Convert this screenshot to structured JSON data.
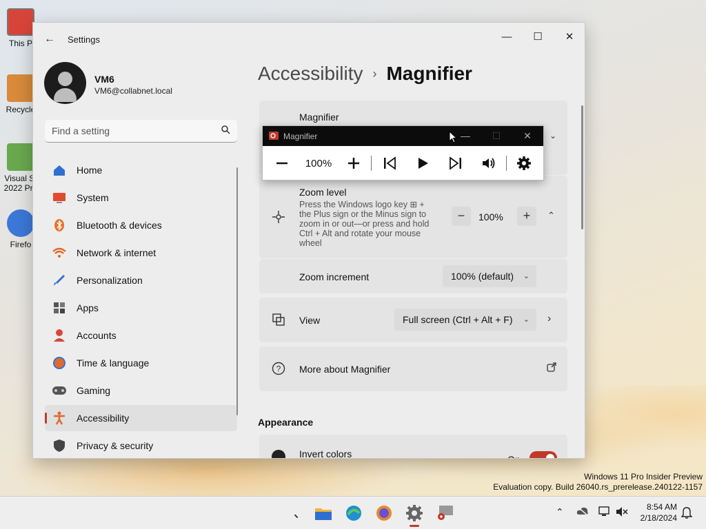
{
  "desktop": {
    "icons": [
      {
        "label": "This P"
      },
      {
        "label": "Recycle"
      },
      {
        "label": "Visual St",
        "label2": "2022 Pre"
      },
      {
        "label": "Firefo"
      }
    ]
  },
  "window": {
    "title": "Settings",
    "controls": {
      "minimize": "—",
      "maximize": "☐",
      "close": "✕"
    }
  },
  "profile": {
    "name": "VM6",
    "email": "VM6@collabnet.local"
  },
  "search": {
    "placeholder": "Find a setting"
  },
  "nav": {
    "items": [
      {
        "label": "Home",
        "icon": "home-icon"
      },
      {
        "label": "System",
        "icon": "system-icon"
      },
      {
        "label": "Bluetooth & devices",
        "icon": "bluetooth-icon"
      },
      {
        "label": "Network & internet",
        "icon": "wifi-icon"
      },
      {
        "label": "Personalization",
        "icon": "brush-icon"
      },
      {
        "label": "Apps",
        "icon": "apps-icon"
      },
      {
        "label": "Accounts",
        "icon": "accounts-icon"
      },
      {
        "label": "Time & language",
        "icon": "globe-clock-icon"
      },
      {
        "label": "Gaming",
        "icon": "controller-icon"
      },
      {
        "label": "Accessibility",
        "icon": "accessibility-icon",
        "active": true
      },
      {
        "label": "Privacy & security",
        "icon": "shield-icon"
      }
    ]
  },
  "breadcrumb": {
    "parent": "Accessibility",
    "separator": "›",
    "current": "Magnifier"
  },
  "magnifier_card": {
    "title": "Magnifier"
  },
  "zoom_level": {
    "title": "Zoom level",
    "description": "Press the Windows logo key ⊞ + the Plus sign or the Minus sign to zoom in or out—or press and hold Ctrl + Alt and rotate your mouse wheel",
    "value": "100%",
    "minus": "−",
    "plus": "+"
  },
  "zoom_increment": {
    "title": "Zoom increment",
    "selected": "100% (default)"
  },
  "view": {
    "title": "View",
    "selected": "Full screen (Ctrl + Alt + F)"
  },
  "more_about": {
    "title": "More about Magnifier"
  },
  "appearance": {
    "heading": "Appearance",
    "invert_colors": {
      "title": "Invert colors",
      "state": "On"
    }
  },
  "magnifier_toolbar": {
    "title": "Magnifier",
    "zoom_value": "100%",
    "tools": [
      "zoom-out",
      "zoom-value",
      "zoom-in",
      "previous",
      "play",
      "next",
      "read-from-here",
      "settings"
    ]
  },
  "taskbar": {
    "clock_time": "8:54 AM",
    "clock_date": "2/18/2024",
    "accent": "#c0392b"
  },
  "watermark": {
    "line1": "Windows 11 Pro Insider Preview",
    "line2": "Evaluation copy. Build 26040.rs_prerelease.240122-1157"
  }
}
